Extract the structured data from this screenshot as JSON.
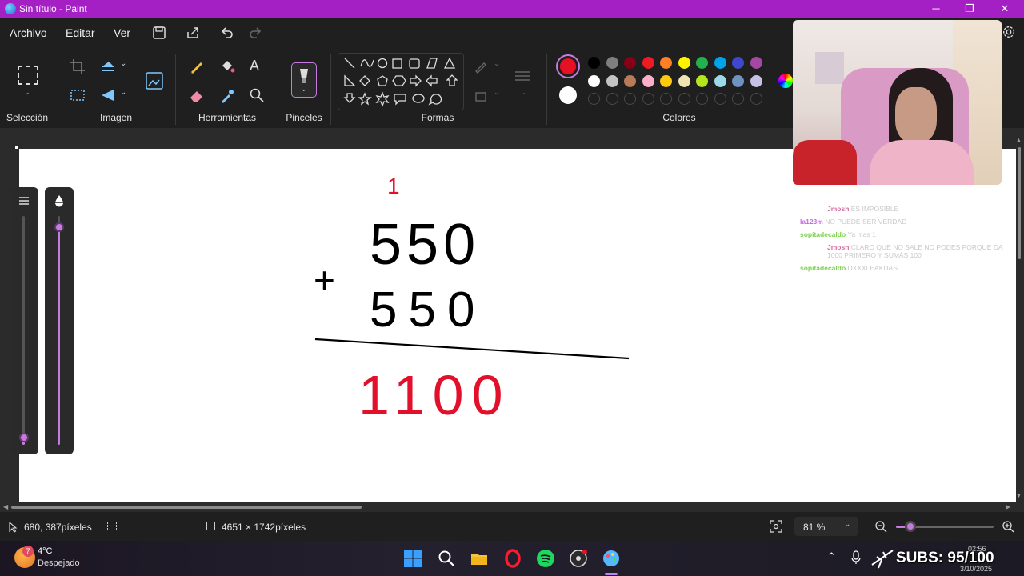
{
  "window": {
    "title": "Sin título - Paint"
  },
  "menu": {
    "archivo": "Archivo",
    "editar": "Editar",
    "ver": "Ver"
  },
  "ribbon": {
    "seleccion": "Selección",
    "imagen": "Imagen",
    "herramientas": "Herramientas",
    "pinceles": "Pinceles",
    "formas": "Formas",
    "colores": "Colores"
  },
  "colors": {
    "accent": "#a41fc4",
    "primary": "#e81123",
    "secondary": "#ffffff",
    "palette_row1": [
      "#000000",
      "#7f7f7f",
      "#880015",
      "#ed1c24",
      "#ff7f27",
      "#fff200",
      "#22b14c",
      "#00a2e8",
      "#3f48cc",
      "#a349a4"
    ],
    "palette_row2": [
      "#ffffff",
      "#c3c3c3",
      "#b97a57",
      "#ffaec9",
      "#ffc90e",
      "#efe4b0",
      "#b5e61d",
      "#99d9ea",
      "#7092be",
      "#c8bfe7"
    ]
  },
  "drawing": {
    "carry": "1",
    "operator": "+",
    "number1": "550",
    "number2": "550",
    "result": "1100"
  },
  "status": {
    "cursor": "680, 387píxeles",
    "size": "4651 × 1742píxeles",
    "zoom": "81 %"
  },
  "brush_size": {
    "level": 0.03
  },
  "opacity": {
    "level": 0.95
  },
  "taskbar": {
    "temp": "4°C",
    "weather": "Despejado",
    "weather_badge": "7",
    "overlay": "SUBS: 95/100",
    "time": "02:56",
    "date": "3/10/2025"
  },
  "chat": [
    {
      "user": "Jmosh",
      "text": "ES IMPOSIBLE",
      "color": "#d36aa0"
    },
    {
      "user": "la123m",
      "text": "NO PUEDE SER VERDAD",
      "color": "#c56ae0"
    },
    {
      "user": "sopitadecaldo",
      "text": "Ya mas 1",
      "color": "#7fd04f"
    },
    {
      "user": "Jmosh",
      "text": "CLARO QUE NO SALE NO PODES PORQUE DA 1000 PRIMERO Y SUMÁS 100",
      "color": "#d36aa0"
    },
    {
      "user": "sopitadecaldo",
      "text": "DXXXLEAKDAS",
      "color": "#7fd04f"
    }
  ]
}
